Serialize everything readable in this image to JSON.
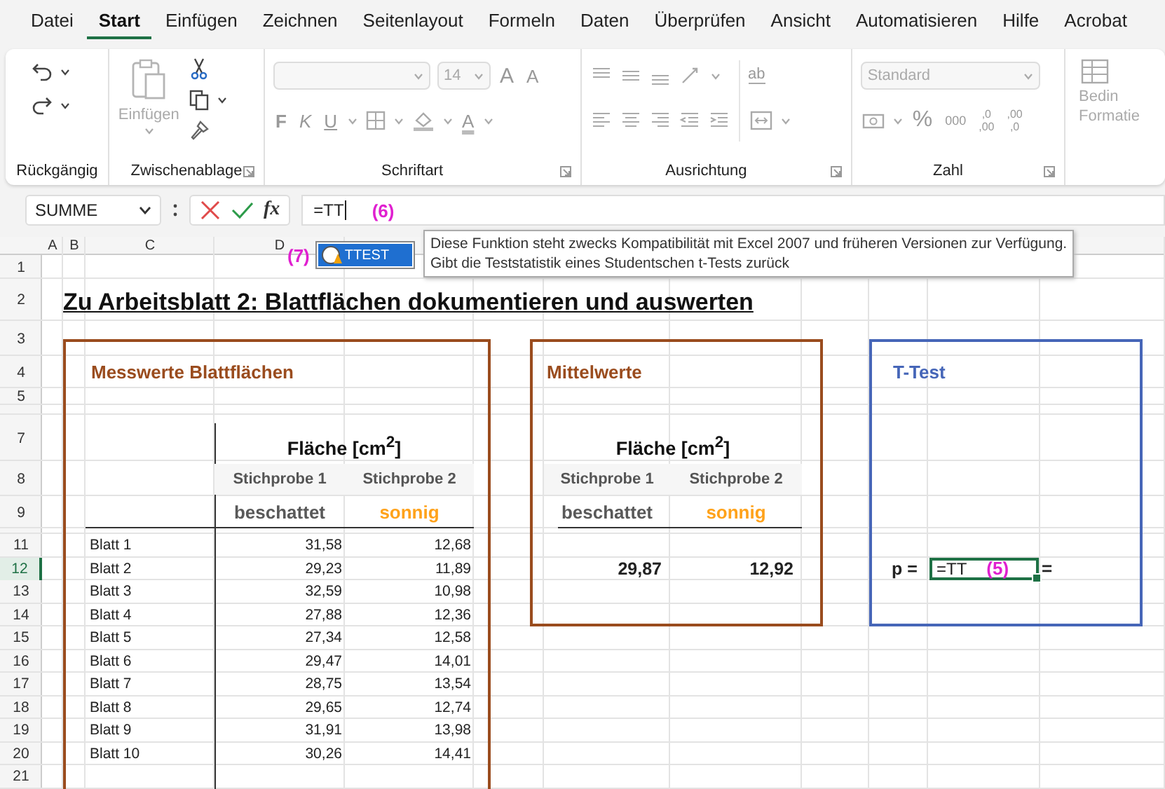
{
  "menu_tabs": [
    {
      "label": "Datei",
      "selected": false
    },
    {
      "label": "Start",
      "selected": true
    },
    {
      "label": "Einfügen",
      "selected": false
    },
    {
      "label": "Zeichnen",
      "selected": false
    },
    {
      "label": "Seitenlayout",
      "selected": false
    },
    {
      "label": "Formeln",
      "selected": false
    },
    {
      "label": "Daten",
      "selected": false
    },
    {
      "label": "Überprüfen",
      "selected": false
    },
    {
      "label": "Ansicht",
      "selected": false
    },
    {
      "label": "Automatisieren",
      "selected": false
    },
    {
      "label": "Hilfe",
      "selected": false
    },
    {
      "label": "Acrobat",
      "selected": false
    }
  ],
  "ribbon": {
    "groups": [
      {
        "kind": "undo",
        "label": "Rückgängig",
        "launcher": false
      },
      {
        "kind": "clipboard",
        "label": "Zwischenablage",
        "launcher": true,
        "paste": {
          "label": "Einfügen",
          "disabled": true
        }
      },
      {
        "kind": "font",
        "label": "Schriftart",
        "launcher": true,
        "disabled": true,
        "size": "14",
        "grow": "A",
        "shrink": "A",
        "bold": "F",
        "italic": "K",
        "underline": "U",
        "color_letter": "A"
      },
      {
        "kind": "alignment",
        "label": "Ausrichtung",
        "launcher": true,
        "disabled": true,
        "wrap": "ab"
      },
      {
        "kind": "number",
        "label": "Zahl",
        "launcher": true,
        "disabled": true,
        "format": "Standard",
        "percent": "%",
        "thousands": "000",
        "increase_decimal": [
          ",0",
          ",00"
        ],
        "decrease_decimal": [
          ",00",
          ",0"
        ]
      },
      {
        "kind": "cut_off",
        "lines": [
          "Bedin",
          "Formatie"
        ],
        "disabled": true
      }
    ]
  },
  "formula_bar": {
    "name_box": "SUMME",
    "fx": "fx",
    "formula": "=TT",
    "annotation": "(6)"
  },
  "sheet": {
    "columns": [
      "A",
      "B",
      "C",
      "D"
    ],
    "rows": [
      {
        "label": "1",
        "selected": false
      },
      {
        "label": "2",
        "selected": false
      },
      {
        "label": "3",
        "selected": false
      },
      {
        "label": "4",
        "selected": false
      },
      {
        "label": "5",
        "selected": false
      },
      {
        "label": "7",
        "selected": false
      },
      {
        "label": "8",
        "selected": false
      },
      {
        "label": "9",
        "selected": false
      },
      {
        "label": "11",
        "selected": false
      },
      {
        "label": "12",
        "selected": true
      },
      {
        "label": "13",
        "selected": false
      },
      {
        "label": "14",
        "selected": false
      },
      {
        "label": "15",
        "selected": false
      },
      {
        "label": "16",
        "selected": false
      },
      {
        "label": "17",
        "selected": false
      },
      {
        "label": "18",
        "selected": false
      },
      {
        "label": "19",
        "selected": false
      },
      {
        "label": "20",
        "selected": false
      },
      {
        "label": "21",
        "selected": false
      }
    ],
    "title": "Zu Arbeitsblatt 2:  Blattflächen dokumentieren und auswerten",
    "autocomplete": {
      "annotation": "(7)",
      "items": [
        {
          "label": "TTEST",
          "selected": true
        }
      ]
    },
    "tooltip": {
      "lines": [
        "Diese Funktion steht zwecks Kompatibilität mit Excel 2007 und früheren Versionen zur Verfügung.",
        "Gibt die Teststatistik eines Studentschen t-Tests zurück"
      ]
    },
    "panels": [
      {
        "kind": "measurements",
        "color": "#9a4c1e",
        "title": "Messwerte Blattflächen",
        "header": "Fläche [cm$^{2}$]",
        "samples": [
          {
            "label": "Stichprobe 1",
            "condition": "beschattet",
            "color": "#595959"
          },
          {
            "label": "Stichprobe 2",
            "condition": "sonnig",
            "color": "#ffa21a"
          }
        ],
        "rows": [
          {
            "label": "Blatt 1",
            "values": [
              "31,58",
              "12,68"
            ]
          },
          {
            "label": "Blatt 2",
            "values": [
              "29,23",
              "11,89"
            ]
          },
          {
            "label": "Blatt 3",
            "values": [
              "32,59",
              "10,98"
            ]
          },
          {
            "label": "Blatt 4",
            "values": [
              "27,88",
              "12,36"
            ]
          },
          {
            "label": "Blatt 5",
            "values": [
              "27,34",
              "12,58"
            ]
          },
          {
            "label": "Blatt 6",
            "values": [
              "29,47",
              "14,01"
            ]
          },
          {
            "label": "Blatt 7",
            "values": [
              "28,75",
              "13,54"
            ]
          },
          {
            "label": "Blatt 8",
            "values": [
              "29,65",
              "12,74"
            ]
          },
          {
            "label": "Blatt 9",
            "values": [
              "31,91",
              "13,98"
            ]
          },
          {
            "label": "Blatt 10",
            "values": [
              "30,26",
              "14,41"
            ]
          }
        ]
      },
      {
        "kind": "means",
        "color": "#9a4c1e",
        "title": "Mittelwerte",
        "header": "Fläche [cm$^{2}$]",
        "samples": [
          {
            "label": "Stichprobe 1",
            "condition": "beschattet",
            "color": "#595959"
          },
          {
            "label": "Stichprobe 2",
            "condition": "sonnig",
            "color": "#ffa21a"
          }
        ],
        "values": [
          "29,87",
          "12,92"
        ]
      },
      {
        "kind": "ttest",
        "color": "#4666b8",
        "title": "T-Test",
        "p_label": "p =",
        "cell": {
          "value": "=TT",
          "annotation": "(5)"
        },
        "after": "="
      }
    ]
  }
}
